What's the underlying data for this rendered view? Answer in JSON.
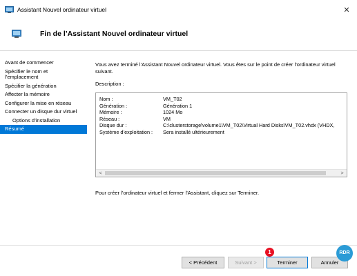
{
  "window": {
    "title": "Assistant Nouvel ordinateur virtuel",
    "close_glyph": "✕"
  },
  "header": {
    "title": "Fin de l’Assistant Nouvel ordinateur virtuel"
  },
  "sidebar": {
    "items": [
      {
        "label": "Avant de commencer"
      },
      {
        "label": "Spécifier le nom et l’emplacement"
      },
      {
        "label": "Spécifier la génération"
      },
      {
        "label": "Affecter la mémoire"
      },
      {
        "label": "Configurer la mise en réseau"
      },
      {
        "label": "Connecter un disque dur virtuel"
      },
      {
        "label": "Options d’installation"
      },
      {
        "label": "Résumé"
      }
    ]
  },
  "content": {
    "intro": "Vous avez terminé l’Assistant Nouvel ordinateur virtuel. Vous êtes sur le point de créer l’ordinateur virtuel suivant.",
    "description_label": "Description :",
    "rows": [
      {
        "key": "Nom :",
        "value": "VM_T02"
      },
      {
        "key": "Génération :",
        "value": "Génération 1"
      },
      {
        "key": "Mémoire :",
        "value": "1024 Mo"
      },
      {
        "key": "Réseau :",
        "value": "VM"
      },
      {
        "key": "Disque dur :",
        "value": "C:\\clusterstorage\\volume1\\VM_T02\\Virtual Hard Disks\\VM_T02.vhdx (VHDX,"
      },
      {
        "key": "Système d’exploitation :",
        "value": "Sera installé ultérieurement"
      }
    ],
    "finish_note": "Pour créer l’ordinateur virtuel et fermer l’Assistant, cliquez sur Terminer."
  },
  "scrollbar": {
    "left_glyph": "<",
    "right_glyph": ">"
  },
  "buttons": {
    "previous": "< Précédent",
    "next": "Suivant >",
    "finish": "Terminer",
    "cancel": "Annuler"
  },
  "annotation": {
    "marker": "1"
  },
  "watermark": {
    "text": "RDR"
  },
  "colors": {
    "accent": "#0078d7",
    "marker": "#e81123"
  }
}
